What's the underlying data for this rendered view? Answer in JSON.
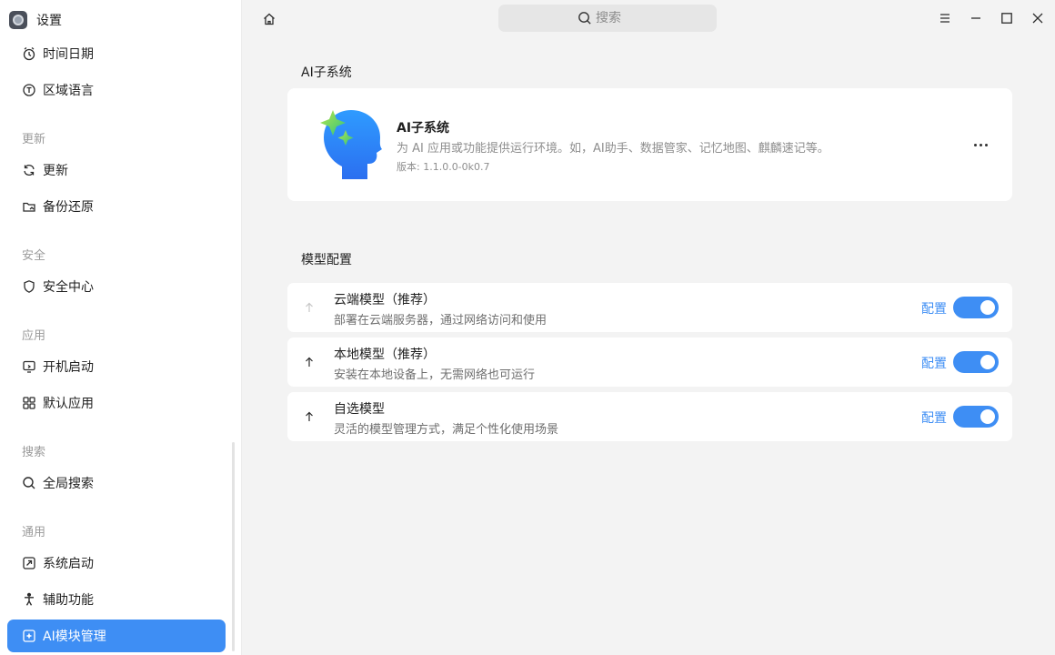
{
  "app": {
    "title": "设置"
  },
  "sidebar": {
    "items": [
      {
        "label": "时间日期",
        "icon": "clock-icon"
      },
      {
        "label": "区域语言",
        "icon": "language-icon"
      },
      {
        "label": "更新",
        "icon": "refresh-icon"
      },
      {
        "label": "备份还原",
        "icon": "backup-icon"
      },
      {
        "label": "安全中心",
        "icon": "shield-icon"
      },
      {
        "label": "开机启动",
        "icon": "startup-icon"
      },
      {
        "label": "默认应用",
        "icon": "apps-grid-icon"
      },
      {
        "label": "全局搜索",
        "icon": "search-icon"
      },
      {
        "label": "系统启动",
        "icon": "boot-icon"
      },
      {
        "label": "辅助功能",
        "icon": "accessibility-icon"
      },
      {
        "label": "AI模块管理",
        "icon": "ai-icon",
        "active": true
      }
    ],
    "groups": {
      "update": "更新",
      "security": "安全",
      "apps": "应用",
      "search": "搜索",
      "general": "通用"
    }
  },
  "topbar": {
    "search_placeholder": "搜索",
    "icons": [
      "home-icon",
      "menu-icon",
      "minimize-icon",
      "maximize-icon",
      "close-icon"
    ]
  },
  "main": {
    "ai_section_title": "AI子系统",
    "ai_card": {
      "name": "AI子系统",
      "description": "为 AI 应用或功能提供运行环境。如，AI助手、数据管家、记忆地图、麒麟速记等。",
      "version": "版本: 1.1.0.0-0k0.7"
    },
    "model_section_title": "模型配置",
    "models": [
      {
        "name": "云端模型（推荐）",
        "description": "部署在云端服务器，通过网络访问和使用",
        "config": "配置",
        "enabled": true,
        "arrow_enabled": false
      },
      {
        "name": "本地模型（推荐）",
        "description": "安装在本地设备上，无需网络也可运行",
        "config": "配置",
        "enabled": true,
        "arrow_enabled": true
      },
      {
        "name": "自选模型",
        "description": "灵活的模型管理方式，满足个性化使用场景",
        "config": "配置",
        "enabled": true,
        "arrow_enabled": true
      }
    ]
  },
  "colors": {
    "accent": "#3e8ef4",
    "background": "#f3f3f3",
    "card": "#ffffff"
  }
}
